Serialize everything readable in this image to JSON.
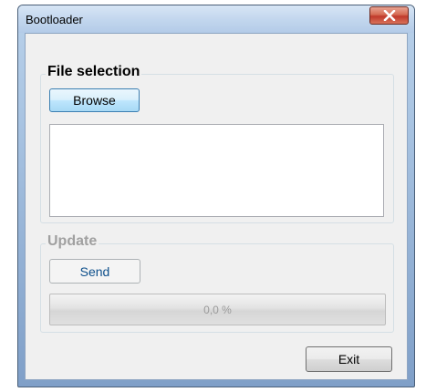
{
  "window": {
    "title": "Bootloader"
  },
  "file_selection": {
    "legend": "File selection",
    "browse_label": "Browse"
  },
  "update": {
    "legend": "Update",
    "send_label": "Send",
    "progress_text": "0,0 %",
    "progress_fraction": 0
  },
  "footer": {
    "exit_label": "Exit"
  },
  "colors": {
    "legend_enabled": "#000000",
    "legend_disabled": "#a0a0a0"
  }
}
